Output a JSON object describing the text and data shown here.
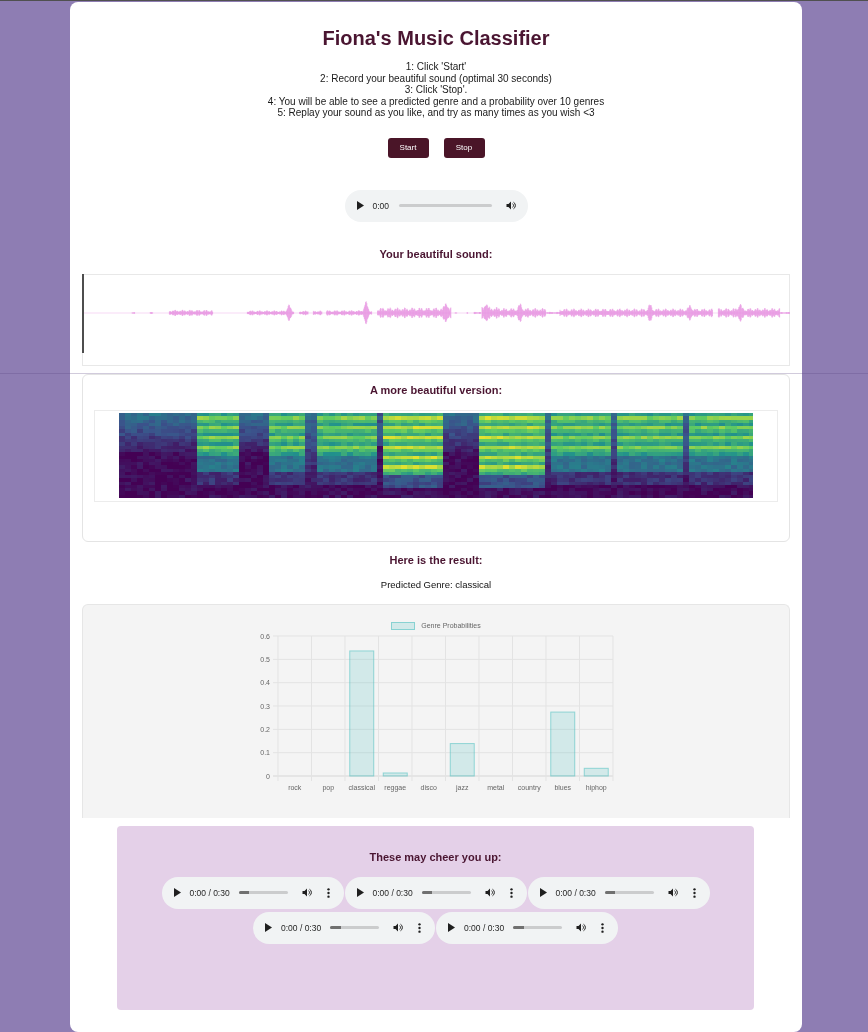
{
  "page": {
    "title": "Fiona's Music Classifier"
  },
  "instructions": [
    "1: Click 'Start'",
    "2: Record your beautiful sound (optimal 30 seconds)",
    "3: Click 'Stop'.",
    "4: You will be able to see a predicted genre and a probability over 10 genres",
    "5: Replay your sound as you like, and try as many times as you wish <3"
  ],
  "buttons": [
    {
      "label": "Start"
    },
    {
      "label": "Stop"
    }
  ],
  "recorder_player": {
    "time": "0:00"
  },
  "recording": {
    "heading": "Your beautiful sound:"
  },
  "spectrogram": {
    "heading": "A more beautiful version:"
  },
  "result": {
    "heading": "Here is the result:",
    "prediction": "Predicted Genre: classical",
    "chart_data": {
      "type": "bar",
      "categories": [
        "rock",
        "pop",
        "classical",
        "reggae",
        "disco",
        "jazz",
        "metal",
        "country",
        "blues",
        "hiphop"
      ],
      "series": [
        {
          "name": "Genre Probabilities",
          "color": "#4bc0c0",
          "values": [
            0,
            0,
            0.536,
            0.013,
            0,
            0.139,
            0,
            0,
            0.274,
            0.033
          ]
        }
      ],
      "ylim": [
        0,
        0.6
      ],
      "yticks": [
        0,
        0.1,
        0.2,
        0.3,
        0.4,
        0.5,
        0.6
      ],
      "grid": true
    }
  },
  "suggestions": {
    "heading": "These may cheer you up:",
    "players": [
      {
        "time": "0:00 / 0:30",
        "level": 0.22
      },
      {
        "time": "0:00 / 0:30",
        "level": 0.22
      },
      {
        "time": "0:00 / 0:30",
        "level": 0.22
      },
      {
        "time": "0:00 / 0:30",
        "level": 0.22
      },
      {
        "time": "0:00 / 0:30",
        "level": 0.22
      }
    ]
  }
}
